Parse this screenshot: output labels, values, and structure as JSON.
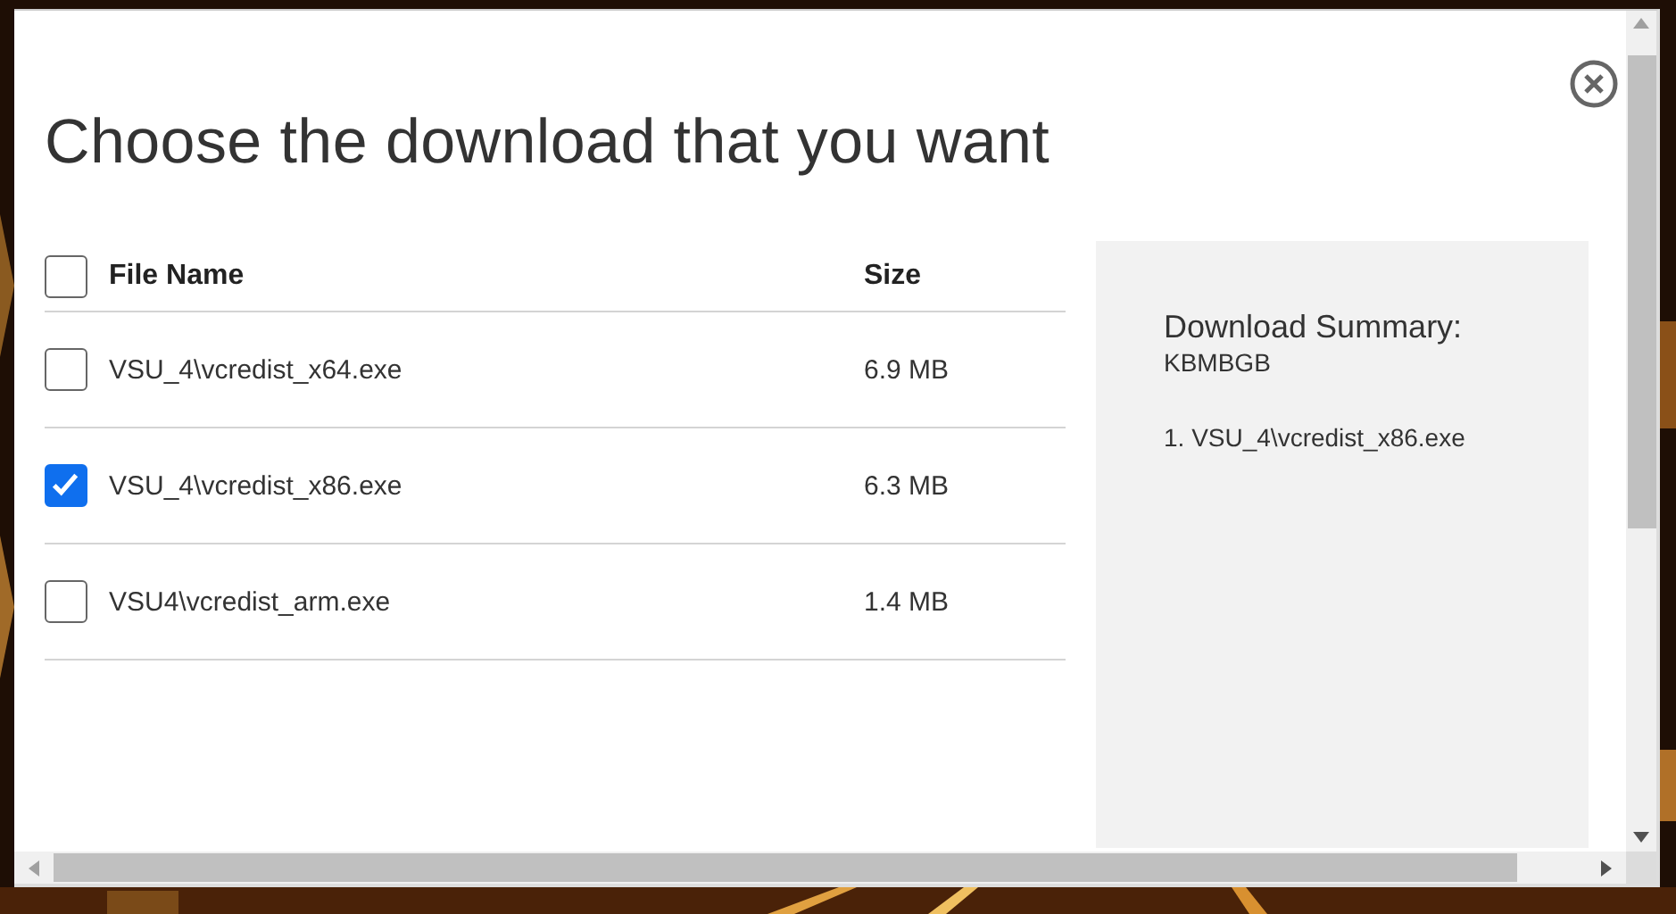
{
  "dialog": {
    "title": "Choose the download that you want"
  },
  "table": {
    "select_all": {
      "checked": false
    },
    "columns": [
      "File Name",
      "Size"
    ],
    "rows": [
      {
        "name": "VSU_4\\vcredist_x64.exe",
        "size": "6.9 MB",
        "checked": false
      },
      {
        "name": "VSU_4\\vcredist_x86.exe",
        "size": "6.3 MB",
        "checked": true
      },
      {
        "name": "VSU4\\vcredist_arm.exe",
        "size": "1.4 MB",
        "checked": false
      }
    ]
  },
  "summary": {
    "title": "Download Summary:",
    "subtitle": "KBMBGB",
    "items": [
      "1. VSU_4\\vcredist_x86.exe"
    ]
  }
}
